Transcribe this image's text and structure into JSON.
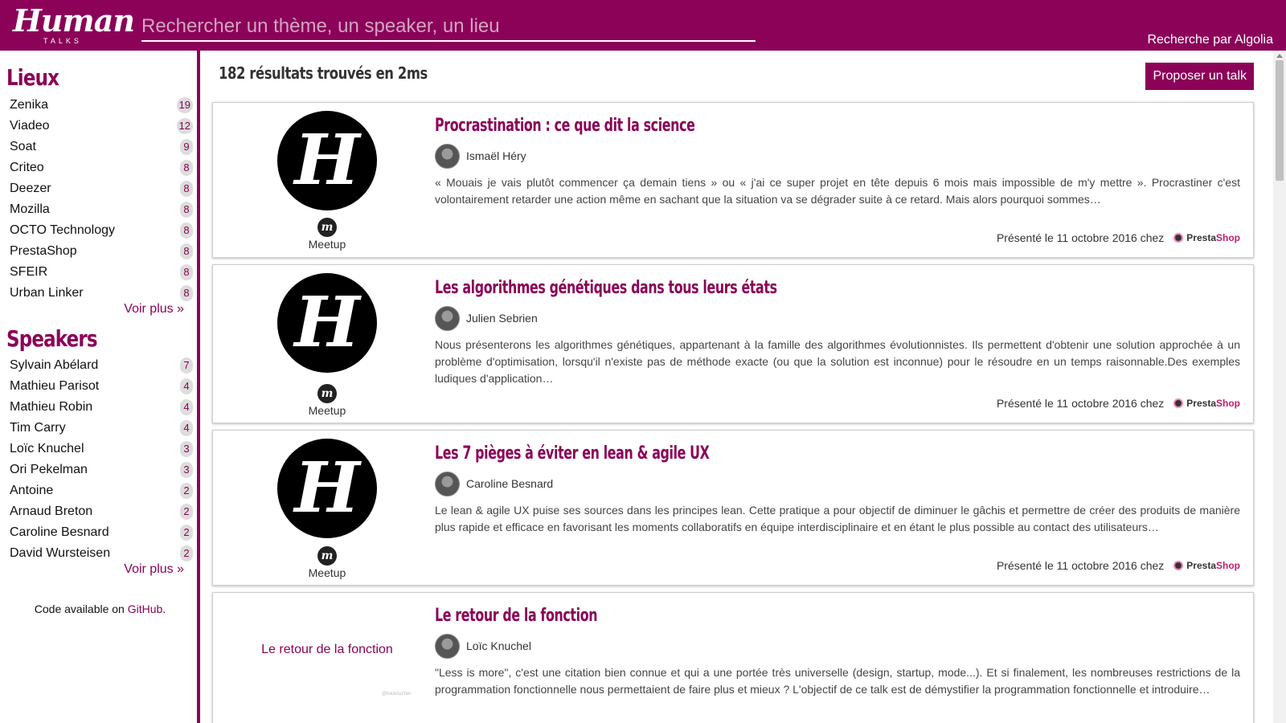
{
  "header": {
    "logo": {
      "main": "Human",
      "sub": "TALKS"
    },
    "search_placeholder": "Rechercher un thème, un speaker, un lieu",
    "search_value": "",
    "powered_by_label": "Recherche par",
    "powered_by_brand": "Algolia"
  },
  "sidebar": {
    "lieux": {
      "title": "Lieux",
      "items": [
        {
          "label": "Zenika",
          "count": "19"
        },
        {
          "label": "Viadeo",
          "count": "12"
        },
        {
          "label": "Soat",
          "count": "9"
        },
        {
          "label": "Criteo",
          "count": "8"
        },
        {
          "label": "Deezer",
          "count": "8"
        },
        {
          "label": "Mozilla",
          "count": "8"
        },
        {
          "label": "OCTO Technology",
          "count": "8"
        },
        {
          "label": "PrestaShop",
          "count": "8"
        },
        {
          "label": "SFEIR",
          "count": "8"
        },
        {
          "label": "Urban Linker",
          "count": "8"
        }
      ],
      "more_label": "Voir plus »"
    },
    "speakers": {
      "title": "Speakers",
      "items": [
        {
          "label": "Sylvain Abélard",
          "count": "7"
        },
        {
          "label": "Mathieu Parisot",
          "count": "4"
        },
        {
          "label": "Mathieu Robin",
          "count": "4"
        },
        {
          "label": "Tim Carry",
          "count": "4"
        },
        {
          "label": "Loïc Knuchel",
          "count": "3"
        },
        {
          "label": "Ori Pekelman",
          "count": "3"
        },
        {
          "label": "Antoine",
          "count": "2"
        },
        {
          "label": "Arnaud Breton",
          "count": "2"
        },
        {
          "label": "Caroline Besnard",
          "count": "2"
        },
        {
          "label": "David Wursteisen",
          "count": "2"
        }
      ],
      "more_label": "Voir plus »"
    },
    "footer": {
      "prefix": "Code available on ",
      "link": "GitHub",
      "suffix": "."
    }
  },
  "main": {
    "result_count": "182 résultats trouvés en 2ms",
    "propose_button": "Proposer un talk",
    "results": [
      {
        "title": "Procrastination : ce que dit la science",
        "speaker": "Ismaël Héry",
        "thumbnail_letter": "H",
        "meetup_icon_letter": "m",
        "meetup_label": "Meetup",
        "description": "« Mouais je vais plutôt commencer ça demain tiens » ou « j'ai ce super projet en tête depuis 6 mois mais impossible de m'y mettre ». Procrastiner c'est volontairement retarder une action même en sachant que la situation va se dégrader suite à ce retard. Mais alors pourquoi sommes…",
        "presented": "Présenté le 11 octobre 2016 chez",
        "sponsor_a": "Presta",
        "sponsor_b": "Shop"
      },
      {
        "title": "Les algorithmes génétiques dans tous leurs états",
        "speaker": "Julien Sebrien",
        "thumbnail_letter": "H",
        "meetup_icon_letter": "m",
        "meetup_label": "Meetup",
        "description": "Nous présenterons les algorithmes génétiques, appartenant à la famille des algorithmes évolutionnistes. Ils permettent d'obtenir une solution approchée à un problème d'optimisation, lorsqu'il n'existe pas de méthode exacte (ou que la solution est inconnue) pour le résoudre en un temps raisonnable.Des exemples ludiques d'application…",
        "presented": "Présenté le 11 octobre 2016 chez",
        "sponsor_a": "Presta",
        "sponsor_b": "Shop"
      },
      {
        "title": "Les 7 pièges à éviter en lean & agile UX",
        "speaker": "Caroline Besnard",
        "thumbnail_letter": "H",
        "meetup_icon_letter": "m",
        "meetup_label": "Meetup",
        "description": "Le lean & agile UX puise ses sources dans les principes lean. Cette pratique a pour objectif de diminuer le gâchis et permettre de créer des produits de manière plus rapide et efficace en favorisant les moments collaboratifs en équipe interdisciplinaire et en étant le plus possible au contact des utilisateurs…",
        "presented": "Présenté le 11 octobre 2016 chez",
        "sponsor_a": "Presta",
        "sponsor_b": "Shop"
      },
      {
        "title": "Le retour de la fonction",
        "speaker": "Loïc Knuchel",
        "slide_title": "Le retour de la fonction",
        "slide_credit": "@loicknuchel",
        "description": "\"Less is more\", c'est une citation bien connue et qui a une portée très universelle (design, startup, mode...). Et si finalement, les nombreuses restrictions de la programmation fonctionnelle nous permettaient de faire plus et mieux ? L'objectif de ce talk est de démystifier la programmation fonctionnelle et introduire…"
      }
    ]
  },
  "colors": {
    "brand": "#8b0258",
    "sponsor_accent": "#c21d6e"
  }
}
